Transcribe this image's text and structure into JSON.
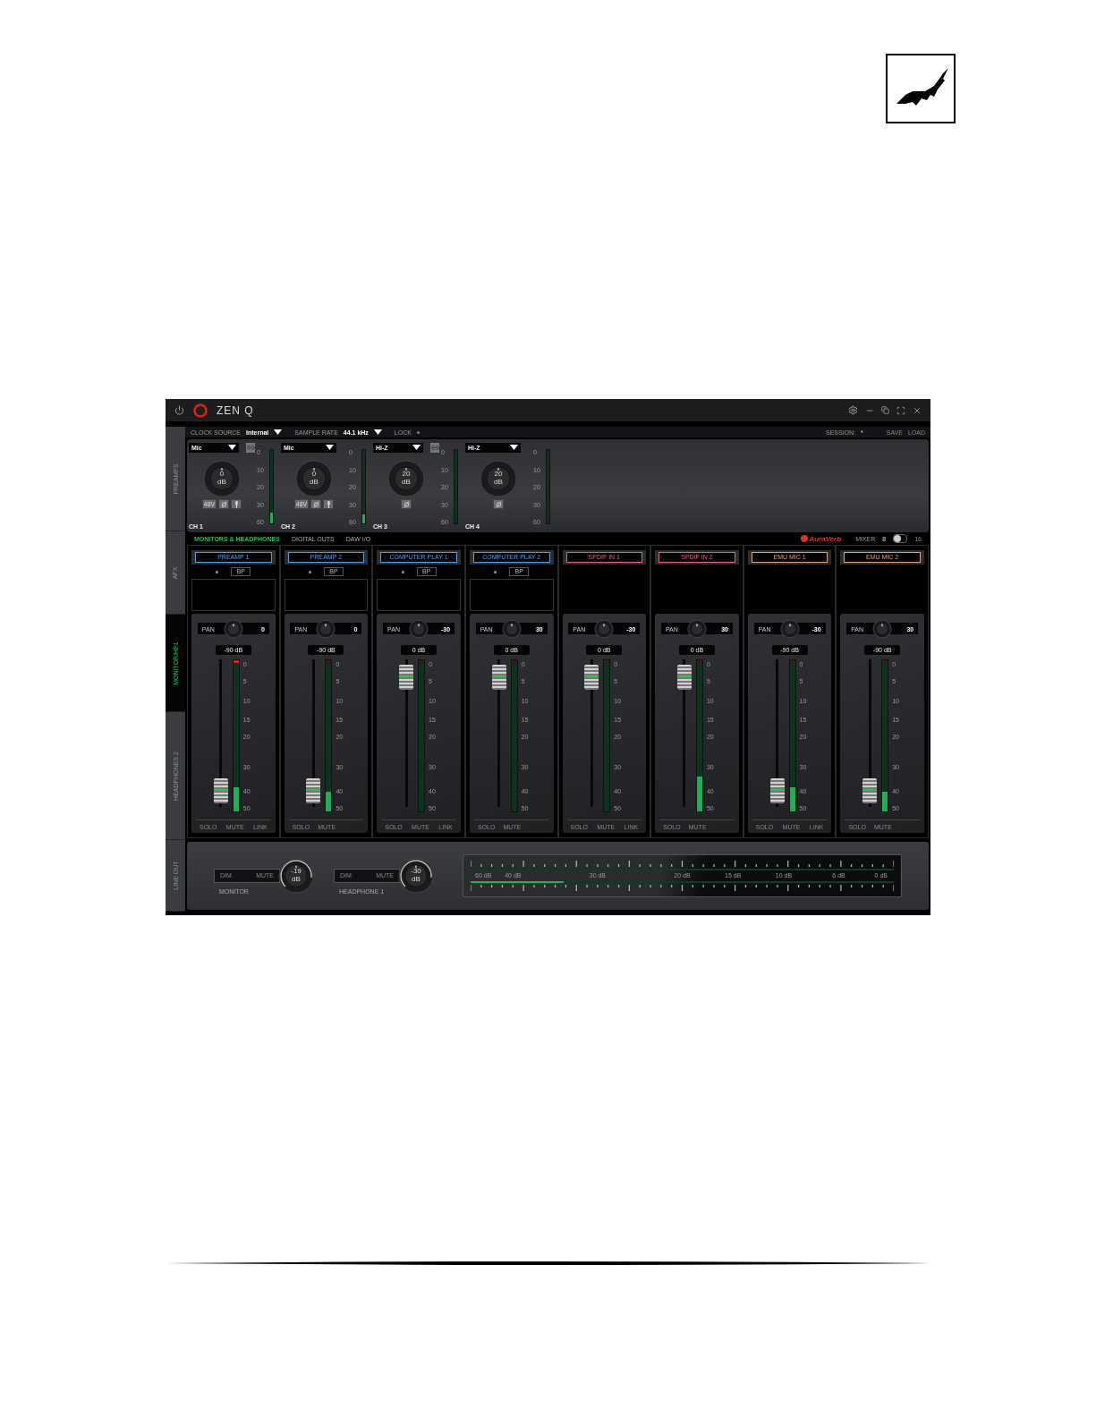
{
  "app": {
    "name": "ZEN Q"
  },
  "side_tabs": [
    {
      "label": "PREAMPS",
      "selected": false
    },
    {
      "label": "AFX",
      "selected": false
    },
    {
      "label": "MONITOR/HP1",
      "selected": true
    },
    {
      "label": "HEADPHONES 2",
      "selected": false
    },
    {
      "label": "LINE OUT",
      "selected": false
    }
  ],
  "top_bar": {
    "clock_source_label": "CLOCK SOURCE",
    "clock_source": "Internal",
    "sample_rate_label": "SAMPLE RATE",
    "sample_rate": "44.1 kHz",
    "lock_label": "LOCK",
    "session_label": "SESSION:",
    "session": "*",
    "save": "SAVE",
    "load": "LOAD"
  },
  "preamps": [
    {
      "input": "Mic",
      "link_button": true,
      "gain": "0",
      "unit": "dB",
      "buttons": [
        {
          "kind": "phantom",
          "label": "48V"
        },
        {
          "kind": "phase"
        },
        {
          "kind": "mic"
        }
      ],
      "label": "CH 1",
      "meter": {
        "level": 0.15
      },
      "scale": [
        "0",
        "10",
        "20",
        "30",
        "60"
      ]
    },
    {
      "input": "Mic",
      "link_button": false,
      "gain": "0",
      "unit": "dB",
      "buttons": [
        {
          "kind": "phantom",
          "label": "48V"
        },
        {
          "kind": "phase"
        },
        {
          "kind": "mic"
        }
      ],
      "label": "CH 2",
      "meter": {
        "level": 0.12
      },
      "scale": [
        "0",
        "10",
        "20",
        "30",
        "60"
      ]
    },
    {
      "input": "Hi-Z",
      "link_button": true,
      "gain": "20",
      "unit": "dB",
      "buttons": [
        {
          "kind": "phase"
        }
      ],
      "label": "CH 3",
      "scale": [
        "0",
        "10",
        "20",
        "30",
        "60"
      ]
    },
    {
      "input": "Hi-Z",
      "link_button": false,
      "gain": "20",
      "unit": "dB",
      "buttons": [
        {
          "kind": "phase"
        }
      ],
      "label": "CH 4",
      "scale": [
        "0",
        "10",
        "20",
        "30",
        "60"
      ]
    }
  ],
  "mixer_tabs": [
    {
      "label": "MONITORS & HEADPHONES",
      "selected": true
    },
    {
      "label": "DIGITAL OUTS",
      "selected": false
    },
    {
      "label": "DAW I/O",
      "selected": false
    }
  ],
  "reverb": "AuraVerb",
  "mixer_label": "MIXER",
  "mixer_modes": [
    {
      "label": "8",
      "selected": true
    },
    {
      "label": "16",
      "selected": false
    }
  ],
  "strips": [
    {
      "kind": "fx",
      "name": "PREAMP 1",
      "color": "#4f9fe6",
      "bypass": "BP",
      "pan_label": "PAN",
      "pan": "0",
      "gain": "-90 dB",
      "fader_up": false,
      "meter": {
        "level": 0.16
      },
      "clip": true,
      "footer": [
        "SOLO",
        "MUTE",
        "LINK"
      ],
      "scale": [
        "0",
        "5",
        "10",
        "15",
        "20",
        "30",
        "40",
        "50"
      ]
    },
    {
      "kind": "fx",
      "name": "PREAMP 2",
      "color": "#4f9fe6",
      "bypass": "BP",
      "pan_label": "PAN",
      "pan": "0",
      "gain": "-90 dB",
      "fader_up": false,
      "meter": {
        "level": 0.13
      },
      "clip": false,
      "footer": [
        "SOLO",
        "MUTE"
      ],
      "scale": [
        "0",
        "5",
        "10",
        "15",
        "20",
        "30",
        "40",
        "50"
      ]
    },
    {
      "kind": "fx",
      "name": "COMPUTER PLAY 1",
      "color": "#4f9fe6",
      "bypass": "BP",
      "pan_label": "PAN",
      "pan": "-30",
      "gain": "0 dB",
      "fader_up": true,
      "meter": {
        "level": 0
      },
      "clip": false,
      "footer": [
        "SOLO",
        "MUTE",
        "LINK"
      ],
      "scale": [
        "0",
        "5",
        "10",
        "15",
        "20",
        "30",
        "40",
        "50"
      ]
    },
    {
      "kind": "fx",
      "name": "COMPUTER PLAY 2",
      "color": "#4f9fe6",
      "bypass": "BP",
      "pan_label": "PAN",
      "pan": "30",
      "gain": "0 dB",
      "fader_up": true,
      "meter": {
        "level": 0
      },
      "clip": false,
      "footer": [
        "SOLO",
        "MUTE"
      ],
      "scale": [
        "0",
        "5",
        "10",
        "15",
        "20",
        "30",
        "40",
        "50"
      ]
    },
    {
      "kind": "plain",
      "name": "SPDIF IN 1",
      "color": "#e0608a",
      "pan_label": "PAN",
      "pan": "-30",
      "gain": "0 dB",
      "fader_up": true,
      "meter": {
        "level": 0
      },
      "clip": false,
      "footer": [
        "SOLO",
        "MUTE",
        "LINK"
      ],
      "scale": [
        "0",
        "5",
        "10",
        "15",
        "20",
        "30",
        "40",
        "50"
      ]
    },
    {
      "kind": "plain",
      "name": "SPDIF IN 2",
      "color": "#e0608a",
      "pan_label": "PAN",
      "pan": "30",
      "gain": "0 dB",
      "fader_up": true,
      "meter": {
        "level": 0.23
      },
      "clip": false,
      "footer": [
        "SOLO",
        "MUTE"
      ],
      "scale": [
        "0",
        "5",
        "10",
        "15",
        "20",
        "30",
        "40",
        "50"
      ]
    },
    {
      "kind": "plain",
      "name": "EMU MIC 1",
      "color": "#e0a27a",
      "pan_label": "PAN",
      "pan": "-30",
      "gain": "-90 dB",
      "fader_up": false,
      "meter": {
        "level": 0.16
      },
      "clip": false,
      "footer": [
        "SOLO",
        "MUTE",
        "LINK"
      ],
      "scale": [
        "0",
        "5",
        "10",
        "15",
        "20",
        "30",
        "40",
        "50"
      ]
    },
    {
      "kind": "plain",
      "name": "EMU MIC 2",
      "color": "#e0a27a",
      "pan_label": "PAN",
      "pan": "30",
      "gain": "-90 dB",
      "fader_up": false,
      "meter": {
        "level": 0.13
      },
      "clip": false,
      "footer": [
        "SOLO",
        "MUTE"
      ],
      "scale": [
        "0",
        "5",
        "10",
        "15",
        "20",
        "30",
        "40",
        "50"
      ]
    }
  ],
  "outputs": [
    {
      "dim": {
        "label": "DIM",
        "on": false
      },
      "mute": {
        "label": "MUTE",
        "on": false
      },
      "value": "-19",
      "unit": "dB",
      "name": "MONITOR"
    },
    {
      "dim": {
        "label": "DIM",
        "on": false
      },
      "mute": {
        "label": "MUTE",
        "on": false
      },
      "value": "-30",
      "unit": "dB",
      "name": "HEADPHONE 1"
    }
  ],
  "output_meter": {
    "labels": [
      "60 dB",
      "40 dB",
      "30 dB",
      "20 dB",
      "15 dB",
      "10 dB",
      "6 dB",
      "0 dB"
    ],
    "level": 0.22
  }
}
